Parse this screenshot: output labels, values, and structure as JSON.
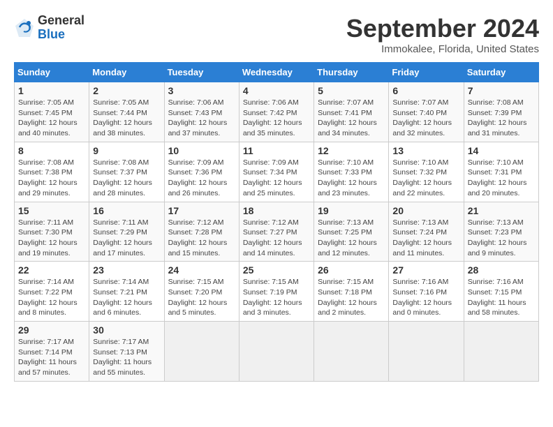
{
  "header": {
    "logo_general": "General",
    "logo_blue": "Blue",
    "month_title": "September 2024",
    "location": "Immokalee, Florida, United States"
  },
  "days_of_week": [
    "Sunday",
    "Monday",
    "Tuesday",
    "Wednesday",
    "Thursday",
    "Friday",
    "Saturday"
  ],
  "weeks": [
    [
      {
        "day": "1",
        "detail": "Sunrise: 7:05 AM\nSunset: 7:45 PM\nDaylight: 12 hours\nand 40 minutes."
      },
      {
        "day": "2",
        "detail": "Sunrise: 7:05 AM\nSunset: 7:44 PM\nDaylight: 12 hours\nand 38 minutes."
      },
      {
        "day": "3",
        "detail": "Sunrise: 7:06 AM\nSunset: 7:43 PM\nDaylight: 12 hours\nand 37 minutes."
      },
      {
        "day": "4",
        "detail": "Sunrise: 7:06 AM\nSunset: 7:42 PM\nDaylight: 12 hours\nand 35 minutes."
      },
      {
        "day": "5",
        "detail": "Sunrise: 7:07 AM\nSunset: 7:41 PM\nDaylight: 12 hours\nand 34 minutes."
      },
      {
        "day": "6",
        "detail": "Sunrise: 7:07 AM\nSunset: 7:40 PM\nDaylight: 12 hours\nand 32 minutes."
      },
      {
        "day": "7",
        "detail": "Sunrise: 7:08 AM\nSunset: 7:39 PM\nDaylight: 12 hours\nand 31 minutes."
      }
    ],
    [
      {
        "day": "8",
        "detail": "Sunrise: 7:08 AM\nSunset: 7:38 PM\nDaylight: 12 hours\nand 29 minutes."
      },
      {
        "day": "9",
        "detail": "Sunrise: 7:08 AM\nSunset: 7:37 PM\nDaylight: 12 hours\nand 28 minutes."
      },
      {
        "day": "10",
        "detail": "Sunrise: 7:09 AM\nSunset: 7:36 PM\nDaylight: 12 hours\nand 26 minutes."
      },
      {
        "day": "11",
        "detail": "Sunrise: 7:09 AM\nSunset: 7:34 PM\nDaylight: 12 hours\nand 25 minutes."
      },
      {
        "day": "12",
        "detail": "Sunrise: 7:10 AM\nSunset: 7:33 PM\nDaylight: 12 hours\nand 23 minutes."
      },
      {
        "day": "13",
        "detail": "Sunrise: 7:10 AM\nSunset: 7:32 PM\nDaylight: 12 hours\nand 22 minutes."
      },
      {
        "day": "14",
        "detail": "Sunrise: 7:10 AM\nSunset: 7:31 PM\nDaylight: 12 hours\nand 20 minutes."
      }
    ],
    [
      {
        "day": "15",
        "detail": "Sunrise: 7:11 AM\nSunset: 7:30 PM\nDaylight: 12 hours\nand 19 minutes."
      },
      {
        "day": "16",
        "detail": "Sunrise: 7:11 AM\nSunset: 7:29 PM\nDaylight: 12 hours\nand 17 minutes."
      },
      {
        "day": "17",
        "detail": "Sunrise: 7:12 AM\nSunset: 7:28 PM\nDaylight: 12 hours\nand 15 minutes."
      },
      {
        "day": "18",
        "detail": "Sunrise: 7:12 AM\nSunset: 7:27 PM\nDaylight: 12 hours\nand 14 minutes."
      },
      {
        "day": "19",
        "detail": "Sunrise: 7:13 AM\nSunset: 7:25 PM\nDaylight: 12 hours\nand 12 minutes."
      },
      {
        "day": "20",
        "detail": "Sunrise: 7:13 AM\nSunset: 7:24 PM\nDaylight: 12 hours\nand 11 minutes."
      },
      {
        "day": "21",
        "detail": "Sunrise: 7:13 AM\nSunset: 7:23 PM\nDaylight: 12 hours\nand 9 minutes."
      }
    ],
    [
      {
        "day": "22",
        "detail": "Sunrise: 7:14 AM\nSunset: 7:22 PM\nDaylight: 12 hours\nand 8 minutes."
      },
      {
        "day": "23",
        "detail": "Sunrise: 7:14 AM\nSunset: 7:21 PM\nDaylight: 12 hours\nand 6 minutes."
      },
      {
        "day": "24",
        "detail": "Sunrise: 7:15 AM\nSunset: 7:20 PM\nDaylight: 12 hours\nand 5 minutes."
      },
      {
        "day": "25",
        "detail": "Sunrise: 7:15 AM\nSunset: 7:19 PM\nDaylight: 12 hours\nand 3 minutes."
      },
      {
        "day": "26",
        "detail": "Sunrise: 7:15 AM\nSunset: 7:18 PM\nDaylight: 12 hours\nand 2 minutes."
      },
      {
        "day": "27",
        "detail": "Sunrise: 7:16 AM\nSunset: 7:16 PM\nDaylight: 12 hours\nand 0 minutes."
      },
      {
        "day": "28",
        "detail": "Sunrise: 7:16 AM\nSunset: 7:15 PM\nDaylight: 11 hours\nand 58 minutes."
      }
    ],
    [
      {
        "day": "29",
        "detail": "Sunrise: 7:17 AM\nSunset: 7:14 PM\nDaylight: 11 hours\nand 57 minutes."
      },
      {
        "day": "30",
        "detail": "Sunrise: 7:17 AM\nSunset: 7:13 PM\nDaylight: 11 hours\nand 55 minutes."
      },
      {
        "day": "",
        "detail": ""
      },
      {
        "day": "",
        "detail": ""
      },
      {
        "day": "",
        "detail": ""
      },
      {
        "day": "",
        "detail": ""
      },
      {
        "day": "",
        "detail": ""
      }
    ]
  ]
}
